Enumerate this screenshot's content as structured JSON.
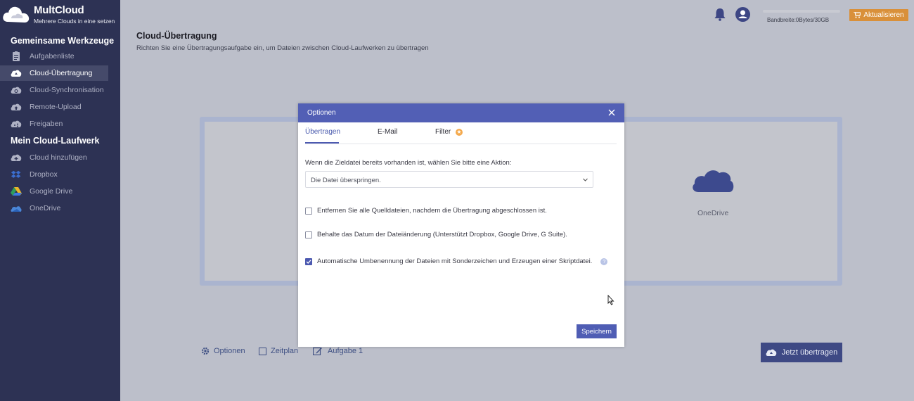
{
  "logo": {
    "title": "MultCloud",
    "subtitle": "Mehrere Clouds in eine setzen"
  },
  "sidebar": {
    "section1": "Gemeinsame Werkzeuge",
    "tools": [
      {
        "label": "Aufgabenliste",
        "icon": "clipboard-icon"
      },
      {
        "label": "Cloud-Übertragung",
        "icon": "cloud-transfer-icon",
        "active": true
      },
      {
        "label": "Cloud-Synchronisation",
        "icon": "cloud-sync-icon"
      },
      {
        "label": "Remote-Upload",
        "icon": "cloud-upload-icon"
      },
      {
        "label": "Freigaben",
        "icon": "cloud-share-icon"
      }
    ],
    "section2": "Mein Cloud-Laufwerk",
    "drives": [
      {
        "label": "Cloud hinzufügen",
        "icon": "cloud-add-icon"
      },
      {
        "label": "Dropbox",
        "icon": "dropbox-icon"
      },
      {
        "label": "Google Drive",
        "icon": "google-drive-icon"
      },
      {
        "label": "OneDrive",
        "icon": "onedrive-icon"
      }
    ]
  },
  "header": {
    "bandwidth": "Bandbreite:0Bytes/30GB",
    "upgrade_label": "Aktualisieren"
  },
  "main": {
    "title": "Cloud-Übertragung",
    "subtitle": "Richten Sie eine Übertragungsaufgabe ein, um Dateien zwischen Cloud-Laufwerken zu übertragen",
    "target_label": "OneDrive",
    "options_label": "Optionen",
    "schedule_label": "Zeitplan",
    "task_label": "Aufgabe 1",
    "start_label": "Jetzt übertragen"
  },
  "modal": {
    "title": "Optionen",
    "tabs": [
      "Übertragen",
      "E-Mail",
      "Filter"
    ],
    "action_label": "Wenn die Zieldatei bereits vorhanden ist, wählen Sie bitte eine Aktion:",
    "action_value": "Die Datei überspringen.",
    "checkboxes": [
      {
        "label": "Entfernen Sie alle Quelldateien, nachdem die Übertragung abgeschlossen ist.",
        "checked": false
      },
      {
        "label": "Behalte das Datum der Dateiänderung (Unterstützt Dropbox, Google Drive, G Suite).",
        "checked": false
      },
      {
        "label": "Automatische Umbenennung der Dateien mit Sonderzeichen und Erzeugen einer Skriptdatei.",
        "checked": true
      }
    ],
    "save_label": "Speichern"
  },
  "colors": {
    "sidebar_bg": "#2d3254",
    "accent": "#525fb5",
    "upgrade": "#d9903a"
  }
}
